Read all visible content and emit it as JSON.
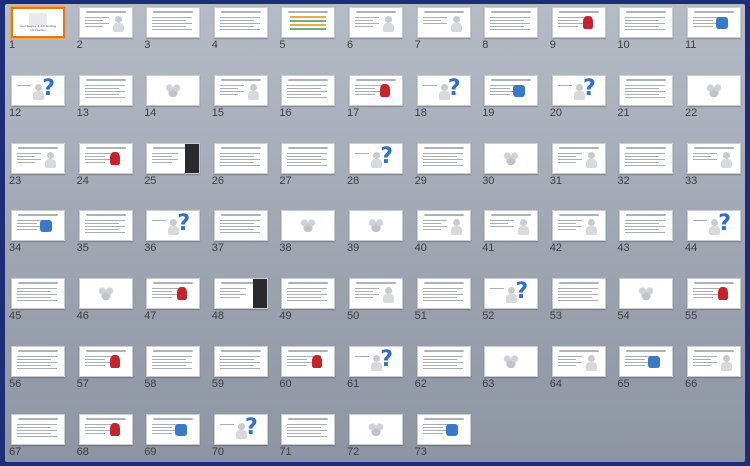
{
  "slides": [
    {
      "n": "1",
      "kind": "cover",
      "selected": true,
      "title": "Your Degree & Job Hunting Introduction"
    },
    {
      "n": "2",
      "kind": "text-img"
    },
    {
      "n": "3",
      "kind": "text"
    },
    {
      "n": "4",
      "kind": "text"
    },
    {
      "n": "5",
      "kind": "stripes"
    },
    {
      "n": "6",
      "kind": "text-img"
    },
    {
      "n": "7",
      "kind": "figure"
    },
    {
      "n": "8",
      "kind": "text"
    },
    {
      "n": "9",
      "kind": "text-red"
    },
    {
      "n": "10",
      "kind": "text"
    },
    {
      "n": "11",
      "kind": "text-blue"
    },
    {
      "n": "12",
      "kind": "question"
    },
    {
      "n": "13",
      "kind": "text"
    },
    {
      "n": "14",
      "kind": "group"
    },
    {
      "n": "15",
      "kind": "text-img"
    },
    {
      "n": "16",
      "kind": "text"
    },
    {
      "n": "17",
      "kind": "text-red"
    },
    {
      "n": "18",
      "kind": "question"
    },
    {
      "n": "19",
      "kind": "text-blue"
    },
    {
      "n": "20",
      "kind": "question"
    },
    {
      "n": "21",
      "kind": "text"
    },
    {
      "n": "22",
      "kind": "group"
    },
    {
      "n": "23",
      "kind": "text-img"
    },
    {
      "n": "24",
      "kind": "text-red"
    },
    {
      "n": "25",
      "kind": "text-dark"
    },
    {
      "n": "26",
      "kind": "text"
    },
    {
      "n": "27",
      "kind": "text"
    },
    {
      "n": "28",
      "kind": "question"
    },
    {
      "n": "29",
      "kind": "text"
    },
    {
      "n": "30",
      "kind": "group"
    },
    {
      "n": "31",
      "kind": "text-img"
    },
    {
      "n": "32",
      "kind": "text"
    },
    {
      "n": "33",
      "kind": "figure"
    },
    {
      "n": "34",
      "kind": "text-blue"
    },
    {
      "n": "35",
      "kind": "text"
    },
    {
      "n": "36",
      "kind": "question"
    },
    {
      "n": "37",
      "kind": "text"
    },
    {
      "n": "38",
      "kind": "group"
    },
    {
      "n": "39",
      "kind": "group"
    },
    {
      "n": "40",
      "kind": "text-img"
    },
    {
      "n": "41",
      "kind": "figure"
    },
    {
      "n": "42",
      "kind": "text-img"
    },
    {
      "n": "43",
      "kind": "text"
    },
    {
      "n": "44",
      "kind": "question"
    },
    {
      "n": "45",
      "kind": "text"
    },
    {
      "n": "46",
      "kind": "group"
    },
    {
      "n": "47",
      "kind": "text-red"
    },
    {
      "n": "48",
      "kind": "text-dark"
    },
    {
      "n": "49",
      "kind": "text"
    },
    {
      "n": "50",
      "kind": "text-img"
    },
    {
      "n": "51",
      "kind": "text"
    },
    {
      "n": "52",
      "kind": "question"
    },
    {
      "n": "53",
      "kind": "text"
    },
    {
      "n": "54",
      "kind": "group"
    },
    {
      "n": "55",
      "kind": "text-red"
    },
    {
      "n": "56",
      "kind": "text"
    },
    {
      "n": "57",
      "kind": "text-red"
    },
    {
      "n": "58",
      "kind": "text"
    },
    {
      "n": "59",
      "kind": "text"
    },
    {
      "n": "60",
      "kind": "text-red"
    },
    {
      "n": "61",
      "kind": "question"
    },
    {
      "n": "62",
      "kind": "text"
    },
    {
      "n": "63",
      "kind": "group"
    },
    {
      "n": "64",
      "kind": "text-img"
    },
    {
      "n": "65",
      "kind": "text-blue"
    },
    {
      "n": "66",
      "kind": "text-img"
    },
    {
      "n": "67",
      "kind": "text"
    },
    {
      "n": "68",
      "kind": "text-red"
    },
    {
      "n": "69",
      "kind": "text-blue"
    },
    {
      "n": "70",
      "kind": "question"
    },
    {
      "n": "71",
      "kind": "text"
    },
    {
      "n": "72",
      "kind": "group"
    },
    {
      "n": "73",
      "kind": "text-blue"
    }
  ],
  "icons": {
    "question": "question-mark-figure-icon",
    "group": "people-group-icon"
  },
  "colors": {
    "frame": "#1c2d7a",
    "selection": "#e0791c",
    "accent_blue": "#2f6fd1",
    "accent_red": "#c8232b"
  }
}
